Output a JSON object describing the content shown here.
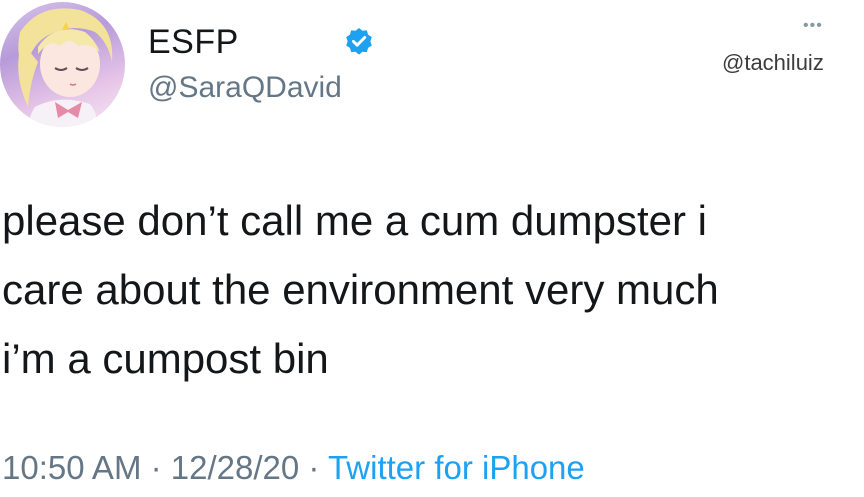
{
  "author": {
    "display_name": "ESFP",
    "handle": "@SaraQDavid",
    "verified": true,
    "verified_icon": "verified-badge-icon",
    "avatar_icon": "anime-avatar"
  },
  "watermark": "@tachiluiz",
  "more_icon": "more-dots-icon",
  "more_glyph": "•••",
  "tweet": {
    "lines": [
      "please don’t call me a cum dumpster i",
      "care about the environment very much",
      "i’m a cumpost bin"
    ]
  },
  "meta": {
    "time": "10:50 AM",
    "separator": " · ",
    "date": "12/28/20",
    "source": "Twitter for iPhone"
  },
  "colors": {
    "text": "#14171a",
    "secondary": "#657786",
    "link": "#1da1f2",
    "background": "#ffffff"
  }
}
